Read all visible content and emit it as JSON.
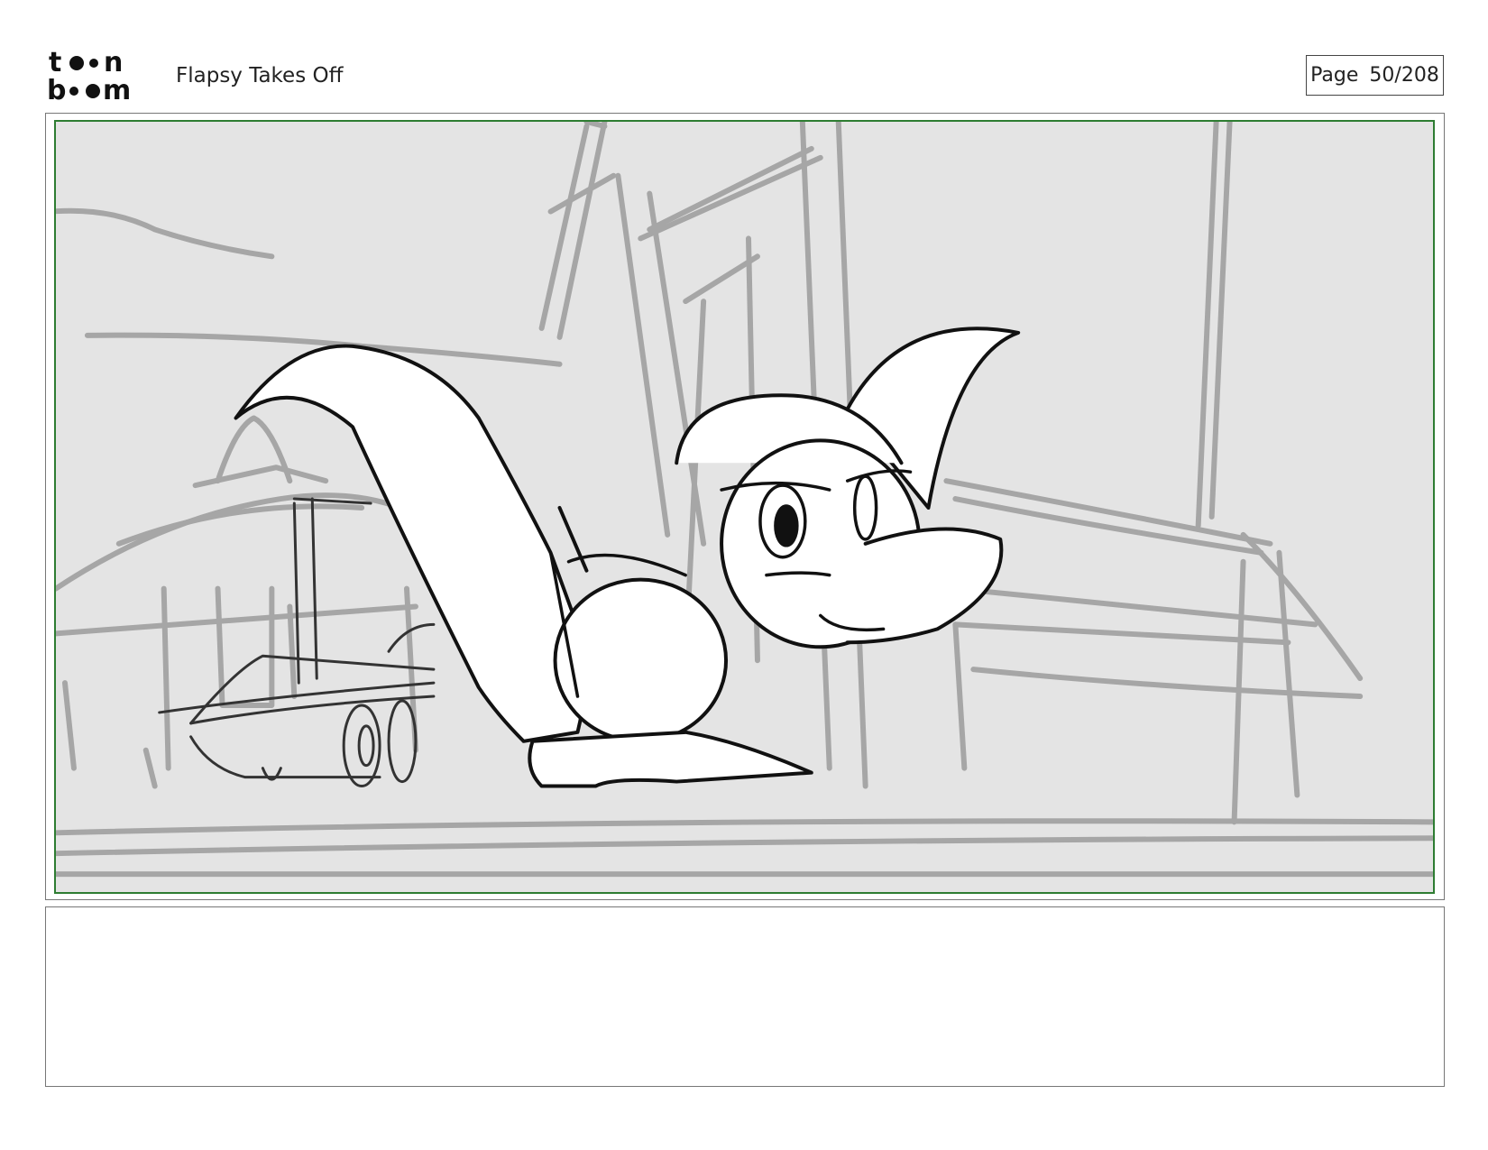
{
  "header": {
    "logo_text": "toon boom",
    "project_title": "Flapsy Takes Off",
    "page_label": "Page",
    "page_number": "50/208"
  },
  "panel": {
    "frame_color": "#2e7d32",
    "background_color": "#e4e4e4",
    "rough_color": "#a6a6a6",
    "ink_color": "#111111"
  },
  "caption": {
    "text": ""
  }
}
